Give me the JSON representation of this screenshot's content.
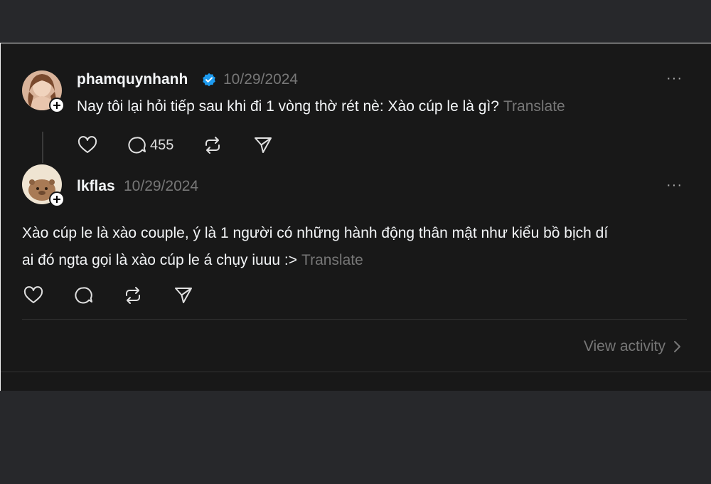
{
  "post": {
    "username": "phamquynhanh",
    "verified": true,
    "date": "10/29/2024",
    "text": "Nay tôi lại hỏi tiếp sau khi đi 1 vòng thờ rét nè: Xào cúp le là gì?",
    "translate_label": "Translate",
    "more_label": "···",
    "reply_count": "455"
  },
  "reply": {
    "username": "lkflas",
    "date": "10/29/2024",
    "text_line1": "Xào cúp le là xào couple, ý là 1 người có những hành động thân mật như kiểu bồ bịch dí",
    "text_line2": "ai đó ngta gọi là xào cúp le á chụy iuuu :>",
    "translate_label": "Translate",
    "more_label": "···"
  },
  "footer": {
    "view_activity_label": "View activity"
  },
  "colors": {
    "background": "#181818",
    "outer_background": "#27282b",
    "text": "#f3f5f7",
    "muted": "#777777",
    "verified": "#1d9bf0"
  }
}
